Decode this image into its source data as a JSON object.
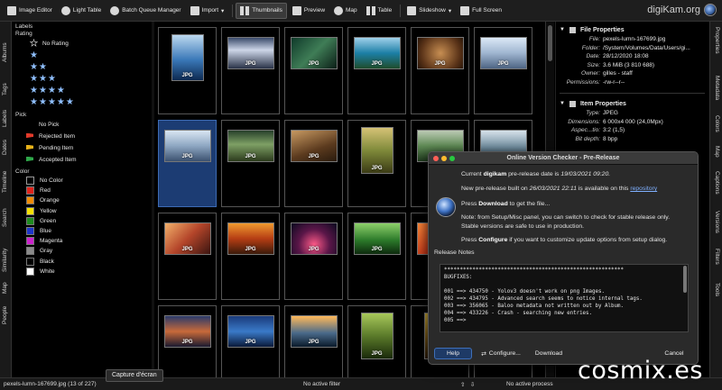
{
  "toolbar": {
    "image_editor": "Image Editor",
    "light_table": "Light Table",
    "batch_queue": "Batch Queue Manager",
    "import": "Import",
    "thumbnails": "Thumbnails",
    "preview": "Preview",
    "map": "Map",
    "table": "Table",
    "slideshow": "Slideshow",
    "full_screen": "Full Screen",
    "brand": "digiKam.org"
  },
  "left_tabs": [
    "Albums",
    "Tags",
    "Labels",
    "Dates",
    "Timeline",
    "Search",
    "Similarity",
    "Map",
    "People"
  ],
  "right_tabs": [
    "Properties",
    "Metadata",
    "Colors",
    "Map",
    "Captions",
    "Versions",
    "Filters",
    "Tools"
  ],
  "labels_panel": {
    "title": "Labels",
    "rating_header": "Rating",
    "no_rating": "No Rating",
    "pick_header": "Pick",
    "picks": [
      "No Pick",
      "Rejected Item",
      "Pending Item",
      "Accepted Item"
    ],
    "color_header": "Color",
    "colors": [
      {
        "name": "No Color",
        "hex": "#ffffff"
      },
      {
        "name": "Red",
        "hex": "#e0241b"
      },
      {
        "name": "Orange",
        "hex": "#f08c00"
      },
      {
        "name": "Yellow",
        "hex": "#f5e000"
      },
      {
        "name": "Green",
        "hex": "#1f8a1f"
      },
      {
        "name": "Blue",
        "hex": "#1e35c8"
      },
      {
        "name": "Magenta",
        "hex": "#cc22cc"
      },
      {
        "name": "Gray",
        "hex": "#8a8a8a"
      },
      {
        "name": "Black",
        "hex": "#000000"
      },
      {
        "name": "White",
        "hex": "#ffffff"
      }
    ]
  },
  "thumbnail_label": "JPG",
  "properties": {
    "file_header": "File Properties",
    "file": [
      {
        "k": "File:",
        "v": "pexels-lumn-167699.jpg"
      },
      {
        "k": "Folder:",
        "v": "/System/Volumes/Data/Users/gi..."
      },
      {
        "k": "Date:",
        "v": "28/12/2020 18:08"
      },
      {
        "k": "Size:",
        "v": "3.6 MiB (3 810 688)"
      },
      {
        "k": "Owner:",
        "v": "gilles - staff"
      },
      {
        "k": "Permissions:",
        "v": "-rw-r--r--"
      }
    ],
    "item_header": "Item Properties",
    "item": [
      {
        "k": "Type:",
        "v": "JPEG"
      },
      {
        "k": "Dimensions:",
        "v": "6 000x4 000 (24,0Mpx)"
      },
      {
        "k": "Aspec...tio:",
        "v": "3:2 (1,5)"
      },
      {
        "k": "Bit depth:",
        "v": "8 bpp"
      }
    ]
  },
  "dialog": {
    "title": "Online Version Checker - Pre-Release",
    "line1_a": "Current ",
    "line1_b": "digikam",
    "line1_c": " pre-release date is ",
    "line1_d": "19/03/2021 09:20.",
    "line2_a": "New pre-release built on ",
    "line2_b": "26/03/2021 22:11",
    "line2_c": " is available on this ",
    "line2_link": "repository",
    "line3_a": "Press ",
    "line3_b": "Download",
    "line3_c": " to get the file...",
    "line4": "Note: from Setup/Misc panel, you can switch to check for stable release only.",
    "line5": "Stable versions are safe to use in production.",
    "line6_a": "Press ",
    "line6_b": "Configure",
    "line6_c": " if you want to customize update options from setup dialog.",
    "release_notes_label": "Release Notes",
    "release_notes": "*********************************************************\nBUGFIXES:\n\n001 ==> 434750 - Yolov3 doesn't work on png Images.\n002 ==> 434795 - Advanced search seems to notice internal tags.\n003 ==> 356065 - Baloo metadata not written out by Album.\n004 ==> 433226 - Crash - searching new entries.\n005 ==>",
    "help": "Help",
    "configure": "Configure...",
    "download": "Download",
    "cancel": "Cancel"
  },
  "status": {
    "file": "pexels-lumn-167699.jpg (13 of 227)",
    "filter": "No active filter",
    "process": "No active process"
  },
  "tooltip": "Capture d'écran",
  "watermark": "cosmix.es"
}
